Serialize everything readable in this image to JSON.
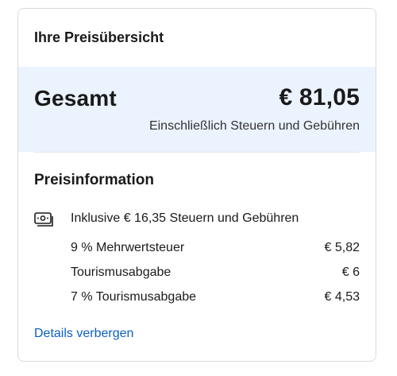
{
  "card": {
    "title": "Ihre Preisübersicht"
  },
  "total": {
    "label": "Gesamt",
    "amount": "€ 81,05",
    "subtext": "Einschließlich Steuern und Gebühren"
  },
  "price_info": {
    "title": "Preisinformation",
    "icon": "money-icon",
    "included_text": "Inklusive € 16,35 Steuern und Gebühren",
    "items": [
      {
        "label": "9 % Mehrwertsteuer",
        "value": "€ 5,82"
      },
      {
        "label": "Tourismusabgabe",
        "value": "€ 6"
      },
      {
        "label": "7 % Tourismusabgabe",
        "value": "€ 4,53"
      }
    ],
    "details_link": "Details verbergen"
  },
  "colors": {
    "highlight_bg": "#ebf3ff",
    "link": "#0a5fc2",
    "border": "#d9d9d9"
  }
}
